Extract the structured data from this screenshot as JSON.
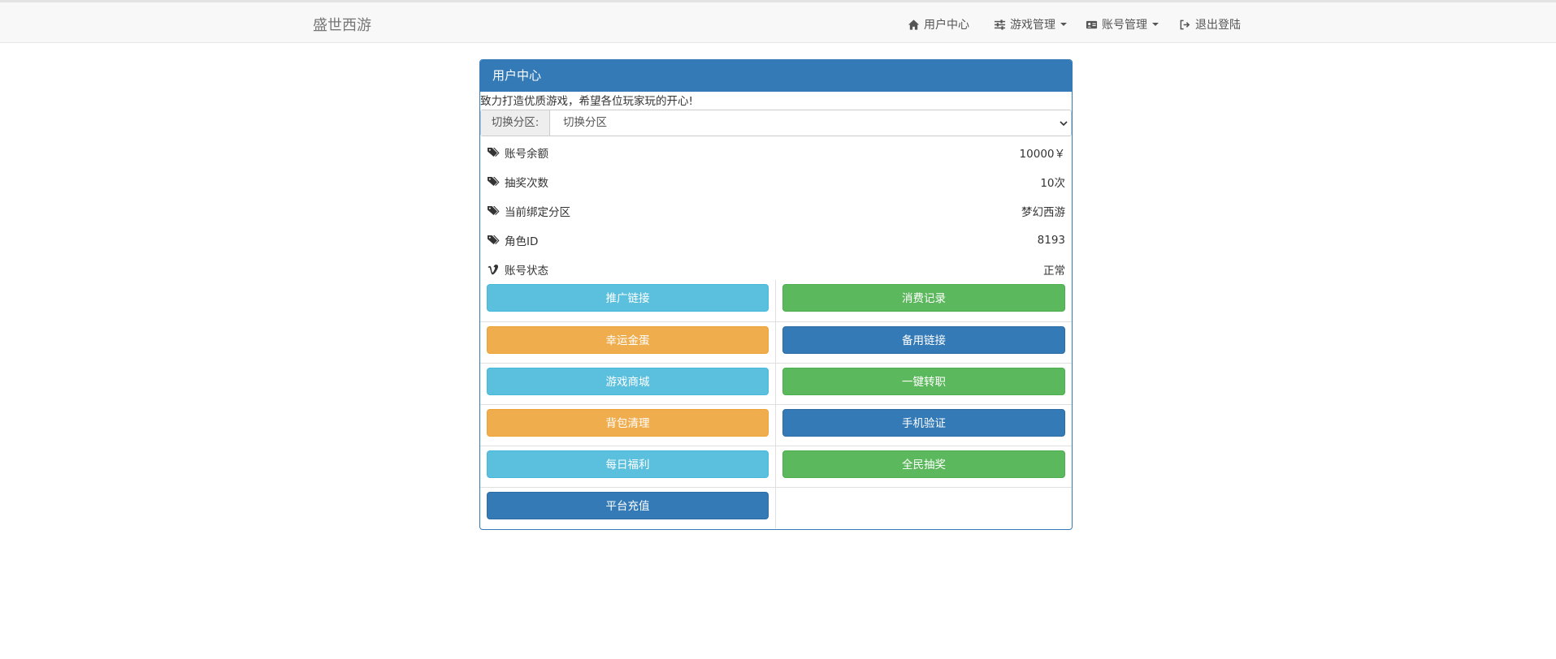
{
  "navbar": {
    "brand": "盛世西游",
    "items": [
      {
        "label": "用户中心",
        "icon": "home-icon"
      },
      {
        "label": "游戏管理",
        "icon": "sliders-icon"
      },
      {
        "label": "账号管理",
        "icon": "id-card-icon"
      },
      {
        "label": "退出登陆",
        "icon": "logout-icon"
      }
    ]
  },
  "panel": {
    "title": "用户中心",
    "intro": "致力打造优质游戏，希望各位玩家玩的开心!",
    "zone": {
      "label": "切换分区:",
      "selected": "切换分区"
    },
    "info": [
      {
        "label": "账号余额",
        "value": "10000￥",
        "icon": "tags-icon"
      },
      {
        "label": "抽奖次数",
        "value": "10次",
        "icon": "tags-icon"
      },
      {
        "label": "当前绑定分区",
        "value": "梦幻西游",
        "icon": "tags-icon"
      },
      {
        "label": "角色ID",
        "value": "8193",
        "icon": "tags-icon"
      },
      {
        "label": "账号状态",
        "value": "正常",
        "icon": "vimeo-icon"
      }
    ],
    "buttons": [
      "推广链接",
      "消费记录",
      "幸运金蛋",
      "备用链接",
      "游戏商城",
      "一键转职",
      "背包清理",
      "手机验证",
      "每日福利",
      "全民抽奖",
      "平台充值"
    ]
  },
  "colors": {
    "primary": "#337ab7",
    "info": "#5bc0de",
    "success": "#5cb85c",
    "warning": "#f0ad4e"
  }
}
